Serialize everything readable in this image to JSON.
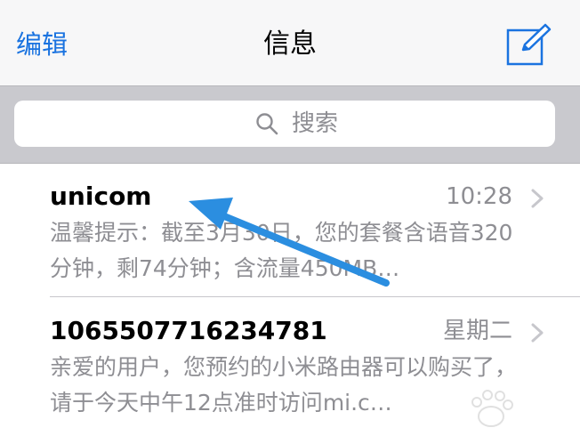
{
  "navbar": {
    "edit_label": "编辑",
    "title": "信息",
    "compose_icon": "compose-icon"
  },
  "search": {
    "placeholder": "搜索",
    "icon": "search-icon"
  },
  "messages": [
    {
      "sender": "unicom",
      "time": "10:28",
      "preview": "温馨提示：截至3月30日，您的套餐含语音320分钟，剩74分钟；含流量450MB…"
    },
    {
      "sender": "1065507716234781",
      "time": "星期二",
      "preview": "亲爱的用户，您预约的小米路由器可以购买了，请于今天中午12点准时访问mi.c…"
    }
  ],
  "annotation": {
    "arrow_color": "#2b8ee0"
  },
  "colors": {
    "accent": "#1a73e0",
    "secondary_text": "#8e8e93",
    "search_bar_bg": "#c9c9ce"
  }
}
